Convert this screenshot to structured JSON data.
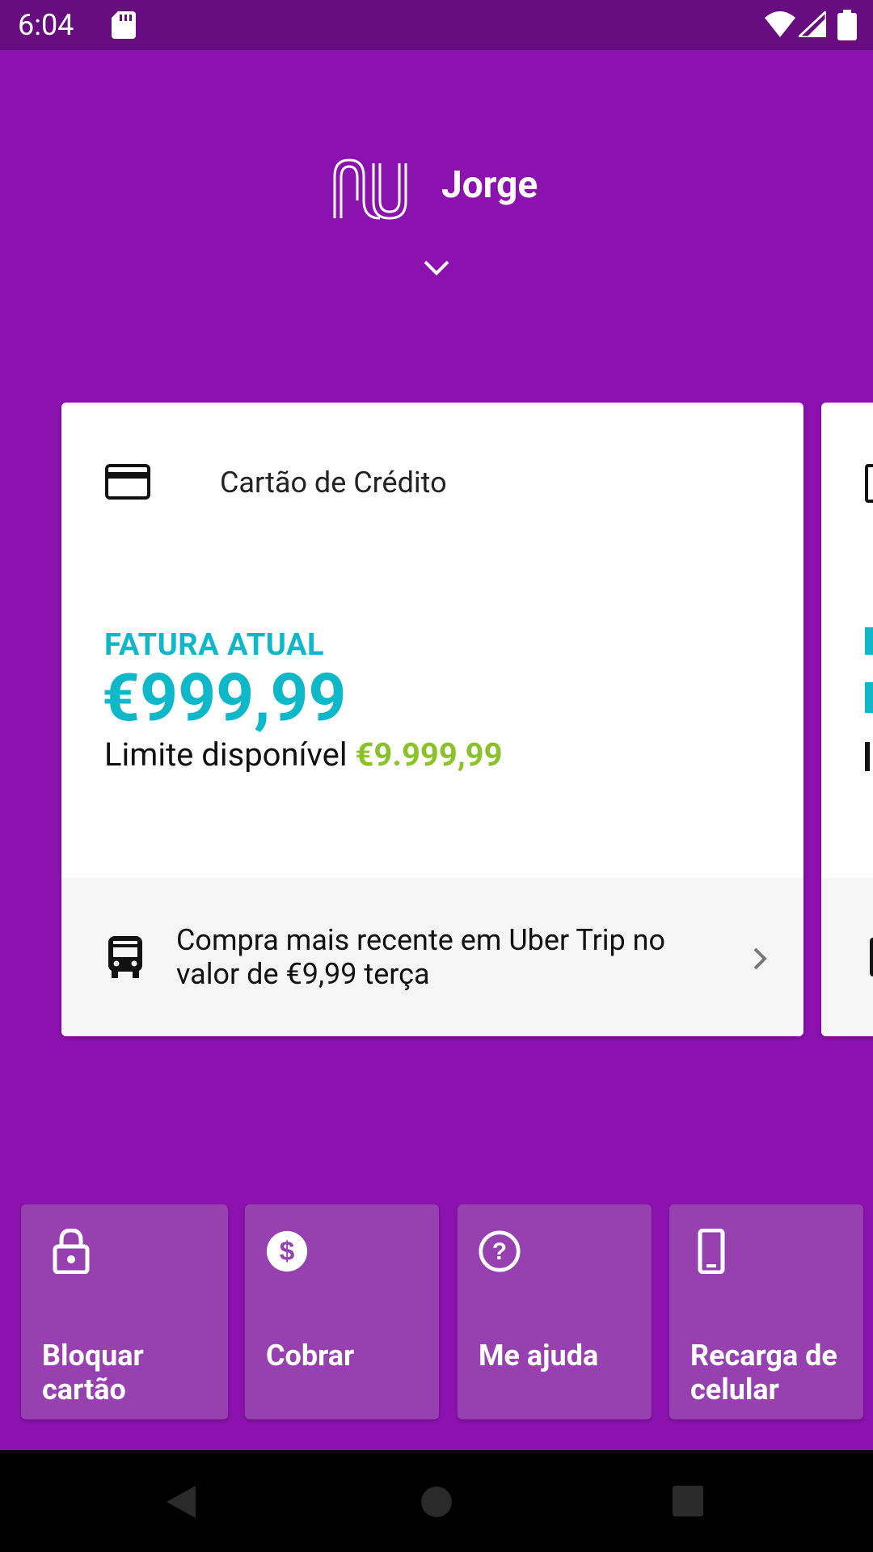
{
  "status_bar": {
    "time": "6:04"
  },
  "header": {
    "user_name": "Jorge"
  },
  "card": {
    "title": "Cartão de Crédito",
    "fatura_label": "FATURA ATUAL",
    "fatura_amount": "€999,99",
    "limit_label": "Limite disponível",
    "limit_value": "€9.999,99",
    "recent_purchase": "Compra mais recente em Uber Trip no valor de €9,99 terça"
  },
  "shortcuts": [
    {
      "label": "Bloquar cartão",
      "icon": "lock-icon"
    },
    {
      "label": "Cobrar",
      "icon": "dollar-icon"
    },
    {
      "label": "Me ajuda",
      "icon": "help-icon"
    },
    {
      "label": "Recarga de celular",
      "icon": "phone-icon"
    }
  ],
  "colors": {
    "background": "#8c12b0",
    "status_bar": "#670d7f",
    "accent": "#0fb8c8",
    "limit_green": "#8bc22a",
    "shortcut_bg": "#9740b0"
  }
}
